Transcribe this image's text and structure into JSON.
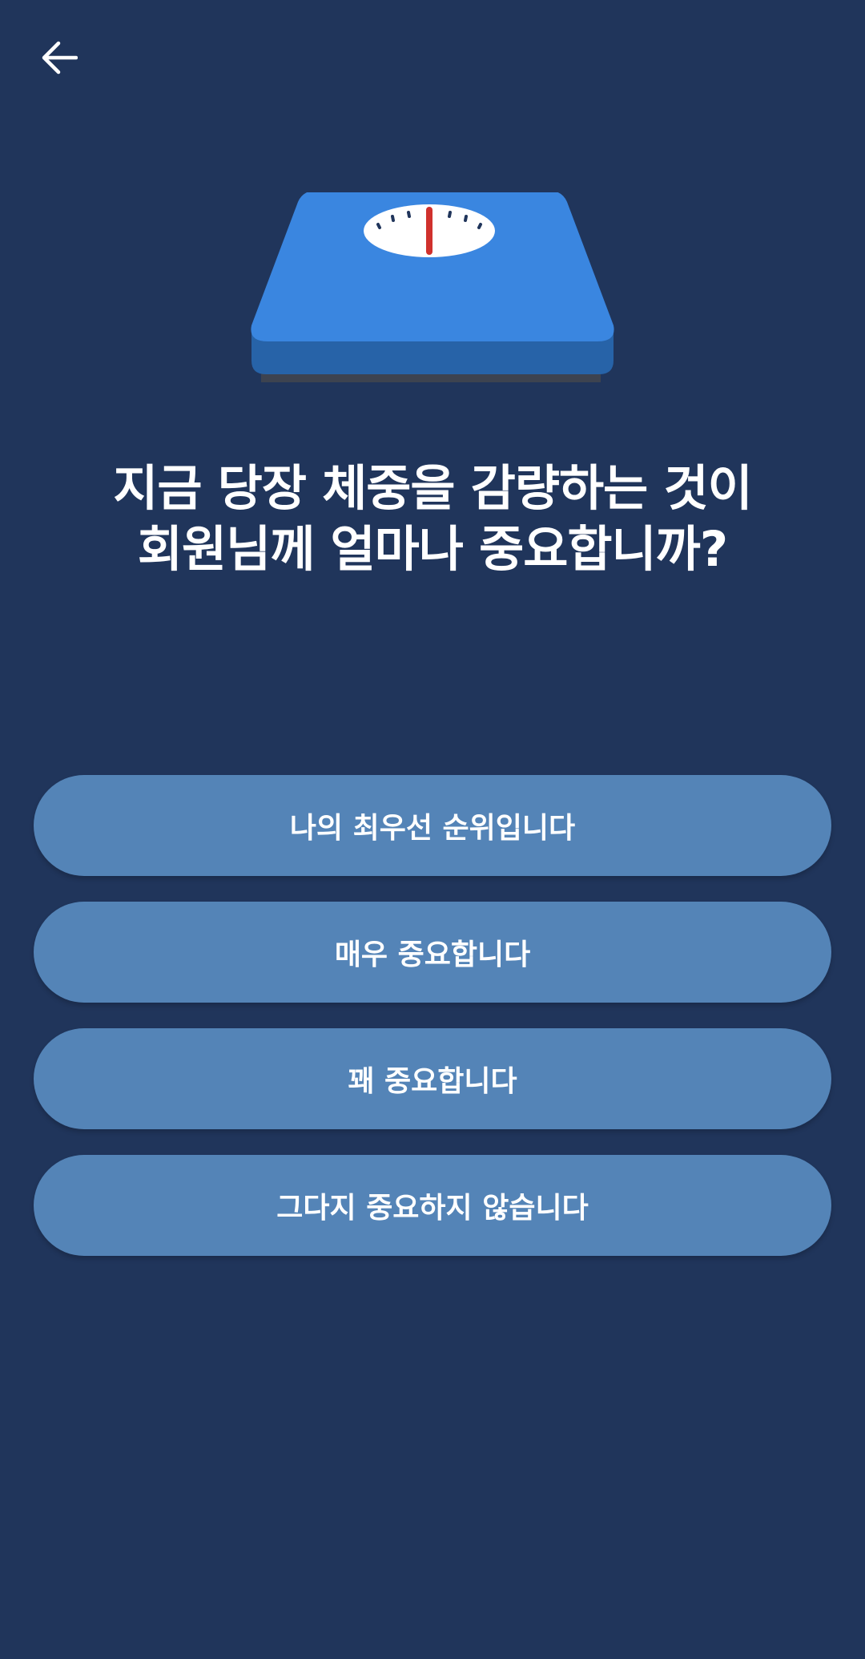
{
  "header": {
    "back_icon": "arrow-left-icon"
  },
  "illustration": {
    "icon": "bathroom-scale-icon",
    "colors": {
      "top": "#3a86e0",
      "side": "#2763a8",
      "base": "#3d4350",
      "dial": "#ffffff",
      "needle": "#d0312d"
    }
  },
  "question": {
    "line1": "지금 당장 체중을 감량하는 것이",
    "line2": "회원님께 얼마나 중요합니까?"
  },
  "options": [
    {
      "label": "나의 최우선 순위입니다"
    },
    {
      "label": "매우 중요합니다"
    },
    {
      "label": "꽤 중요합니다"
    },
    {
      "label": "그다지 중요하지 않습니다"
    }
  ],
  "colors": {
    "background": "#20355b",
    "option_background": "#5484b7",
    "text": "#ffffff"
  }
}
